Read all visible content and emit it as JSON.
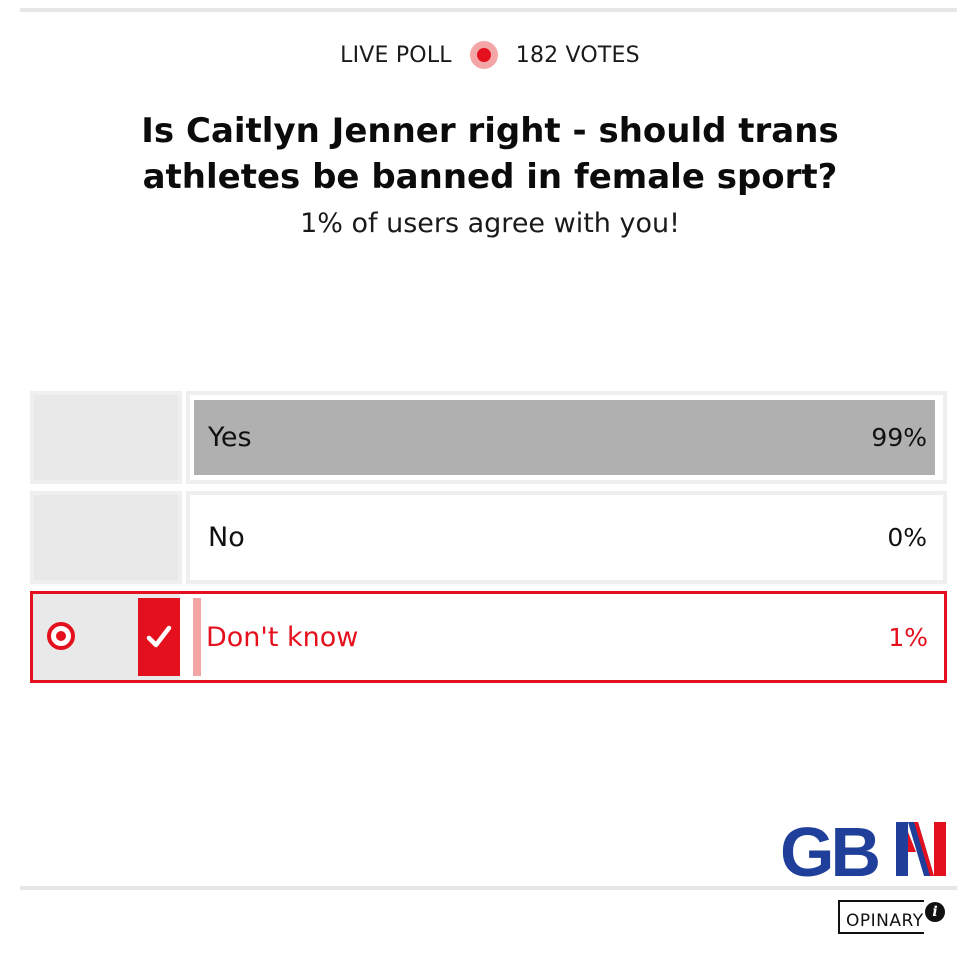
{
  "poll": {
    "live_label": "LIVE POLL",
    "votes_label": "182 VOTES",
    "question": "Is Caitlyn Jenner right - should trans athletes be banned in female sport?",
    "agreement_text": "1% of users agree with you!",
    "options": [
      {
        "label": "Yes",
        "percent_text": "99%",
        "share": 99,
        "selected": false
      },
      {
        "label": "No",
        "percent_text": "0%",
        "share": 0,
        "selected": false
      },
      {
        "label": "Don't know",
        "percent_text": "1%",
        "share": 1,
        "selected": true
      }
    ]
  },
  "branding": {
    "logo_text": "GBN",
    "powered_by": "OPINARY",
    "info_icon": "info-icon"
  },
  "colors": {
    "accent": "#e4101d",
    "bar_fill": "#b0b0b0",
    "selected_bar_fill": "#f4a6a6",
    "logo_blue": "#1f3f9a"
  }
}
